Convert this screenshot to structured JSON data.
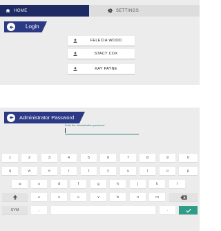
{
  "login_screen": {
    "tabs": {
      "home_label": "HOME",
      "home_icon": "home-icon",
      "settings_label": "SETTINGS",
      "settings_icon": "gear-icon"
    },
    "title": "Login",
    "back_icon": "arrow-left-icon",
    "users": [
      "FELECIA WOOD",
      "STACY COX",
      "KAY PAYNE"
    ],
    "user_icon": "person-icon"
  },
  "password_screen": {
    "title": "Administrator Password",
    "back_icon": "arrow-left-icon",
    "prompt": "Enter the administration password",
    "password_value": "",
    "keyboard": {
      "row1": [
        "1",
        "2",
        "3",
        "4",
        "5",
        "6",
        "7",
        "8",
        "9",
        "0"
      ],
      "row2": [
        "q",
        "w",
        "e",
        "r",
        "t",
        "y",
        "u",
        "i",
        "o",
        "p"
      ],
      "row3": [
        "a",
        "s",
        "d",
        "f",
        "g",
        "h",
        "j",
        "k",
        "l"
      ],
      "row4": [
        "z",
        "x",
        "c",
        "v",
        "b",
        "n",
        "m"
      ],
      "sym_label": "SYM",
      "comma_label": ",",
      "period_label": ".",
      "shift_icon": "shift-icon",
      "backspace_icon": "backspace-icon",
      "enter_icon": "checkmark-icon"
    }
  },
  "colors": {
    "tab_active": "#1e2a63",
    "banner": "#2c3a86",
    "accent": "#2e7d7d",
    "enter_key": "#2e9d88",
    "panel_bg": "#ececec"
  }
}
